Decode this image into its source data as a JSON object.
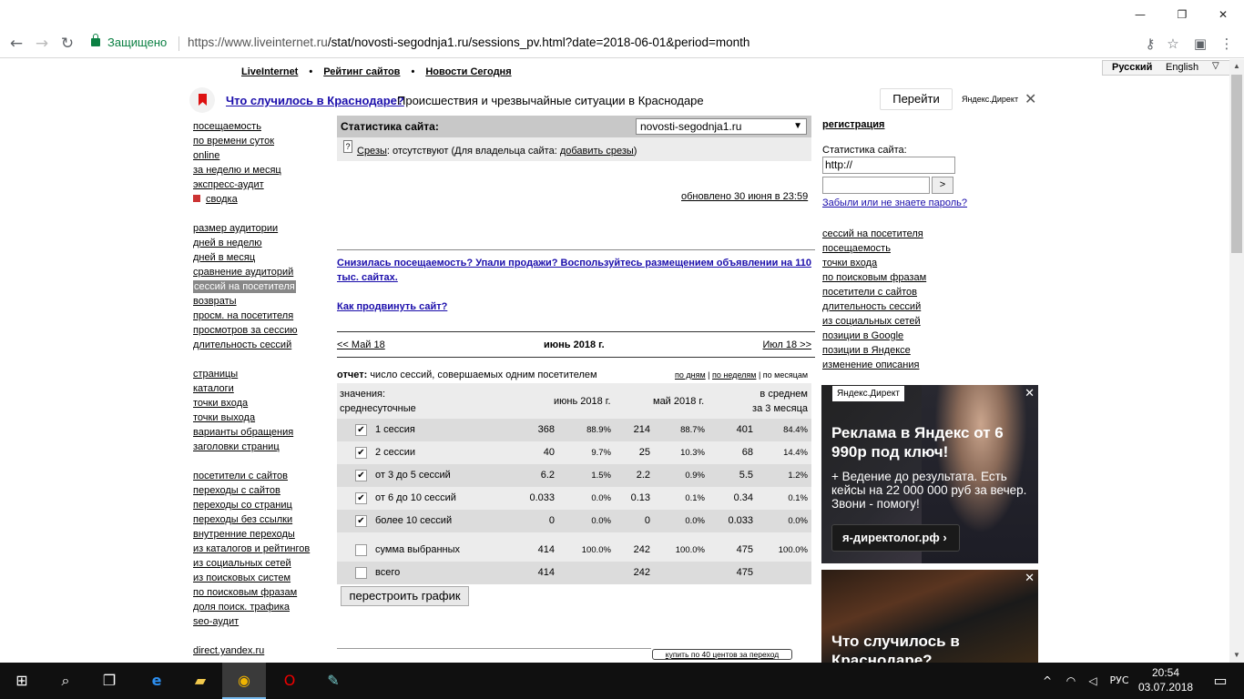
{
  "browser": {
    "secure_label": "Защищено",
    "url_host": "https://www.liveinternet.ru",
    "url_path": "/stat/novosti-segodnja1.ru/sessions_pv.html?date=2018-06-01&period=month"
  },
  "topnav": {
    "items": [
      "LiveInternet",
      "Рейтинг сайтов",
      "Новости Сегодня"
    ]
  },
  "lang": {
    "ru": "Русский",
    "en": "English",
    "arrow": "▽"
  },
  "adbar": {
    "headline": "Что случилось в Краснодаре?",
    "text": "Происшествия и чрезвычайные ситуации в Краснодаре",
    "button": "Перейти",
    "source": "Яндекс.Директ"
  },
  "leftmenu": {
    "group1": [
      "посещаемость",
      "по времени суток",
      "online",
      "за неделю и месяц",
      "экспресс-аудит",
      "сводка"
    ],
    "group2": [
      "размер аудитории",
      "дней в неделю",
      "дней в месяц",
      "сравнение аудиторий",
      "сессий на посетителя",
      "возвраты",
      "просм. на посетителя",
      "просмотров за сессию",
      "длительность сессий"
    ],
    "group3": [
      "страницы",
      "каталоги",
      "точки входа",
      "точки выхода",
      "варианты обращения",
      "заголовки страниц"
    ],
    "group4": [
      "посетители с сайтов",
      "переходы с сайтов",
      "переходы со страниц",
      "переходы без ссылки",
      "внутренние переходы",
      "из каталогов и рейтингов",
      "из социальных сетей",
      "из поисковых систем",
      "по поисковым фразам",
      "доля поиск. трафика",
      "seo-аудит"
    ],
    "group5": [
      "direct.yandex.ru"
    ]
  },
  "stat": {
    "label": "Статистика сайта:",
    "site": "novosti-segodnja1.ru",
    "srezy_link": "Срезы",
    "srezy_text": ": отсутствуют (Для владельца сайта: ",
    "srezy_add": "добавить срезы",
    "srezy_end": ")",
    "updated": "обновлено 30 июня в 23:59"
  },
  "promo": {
    "line1": "Снизилась посещаемость? Упали продажи? Воспользуйтесь размещением объявлении на 110 тыс. сайтах.",
    "line2": "Как продвинуть сайт?"
  },
  "monthnav": {
    "prev": "<< Май 18",
    "current": "июнь 2018 г.",
    "next": "Июл 18 >>"
  },
  "report": {
    "label": "отчет:",
    "text": "число сессий, совершаемых одним посетителем"
  },
  "periods": [
    "по дням",
    "по неделям",
    "по месяцам"
  ],
  "table": {
    "head_values": "значения:",
    "head_type": "среднесуточные",
    "col1": "июнь 2018 г.",
    "col2": "май 2018 г.",
    "col3a": "в среднем",
    "col3b": "за 3 месяца",
    "rows": [
      {
        "label": "1 сессия",
        "checked": true,
        "v1": "368",
        "p1": "88.9%",
        "v2": "214",
        "p2": "88.7%",
        "v3": "401",
        "p3": "84.4%"
      },
      {
        "label": "2 сессии",
        "checked": true,
        "v1": "40",
        "p1": "9.7%",
        "v2": "25",
        "p2": "10.3%",
        "v3": "68",
        "p3": "14.4%"
      },
      {
        "label": "от 3 до 5 сессий",
        "checked": true,
        "v1": "6.2",
        "p1": "1.5%",
        "v2": "2.2",
        "p2": "0.9%",
        "v3": "5.5",
        "p3": "1.2%"
      },
      {
        "label": "от 6 до 10 сессий",
        "checked": true,
        "v1": "0.033",
        "p1": "0.0%",
        "v2": "0.13",
        "p2": "0.1%",
        "v3": "0.34",
        "p3": "0.1%"
      },
      {
        "label": "более 10 сессий",
        "checked": true,
        "v1": "0",
        "p1": "0.0%",
        "v2": "0",
        "p2": "0.0%",
        "v3": "0.033",
        "p3": "0.0%"
      }
    ],
    "sum": {
      "label": "сумма выбранных",
      "v1": "414",
      "p1": "100.0%",
      "v2": "242",
      "p2": "100.0%",
      "v3": "475",
      "p3": "100.0%"
    },
    "total": {
      "label": "всего",
      "v1": "414",
      "v2": "242",
      "v3": "475"
    }
  },
  "rebuild_button": "перестроить график",
  "buy_link": "купить по 40 центов за переход",
  "right": {
    "registration": "регистрация",
    "stat_label": "Статистика сайта:",
    "url_value": "http://",
    "go": ">",
    "forgot": "Забыли или не знаете пароль?",
    "links": [
      "сессий на посетителя",
      "посещаемость",
      "точки входа",
      "по поисковым фразам",
      "посетители с сайтов",
      "длительность сессий",
      "из социальных сетей",
      "позиции в Google",
      "позиции в Яндексе",
      "изменение описания"
    ]
  },
  "ad1": {
    "tag": "Яндекс.Директ",
    "headline": "Реклама в Яндекс от 6 990р под ключ!",
    "text": "+ Ведение до результата. Есть кейсы на 22 000 000 руб за вечер. Звони - помогу!",
    "button": "я-директолог.рф ›"
  },
  "ad2": {
    "headline": "Что случилось в Краснодаре?"
  },
  "taskbar": {
    "lang": "РУС",
    "time": "20:54",
    "date": "03.07.2018"
  }
}
